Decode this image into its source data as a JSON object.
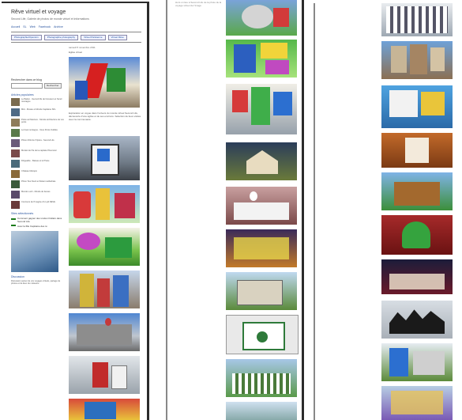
{
  "blog": {
    "title": "Rêve virtuel et voyage",
    "subtitle": "Second Life, Galerie de photos de monde virtuel et informations",
    "nav": [
      "Accueil",
      "SL",
      "Web",
      "Facebook",
      "Archive"
    ],
    "tabs": [
      "Photographie/Opensim",
      "Photographie photography",
      "Virtuel Parisienne",
      "Virtuel Rêve"
    ],
    "post_date": "samedi 5 novembre 2011",
    "post_title": "Eglise virtuel",
    "search_label": "Rechercher dans ce blog",
    "search_button": "Rechercher",
    "sections": {
      "popular": "Articles populaires",
      "selected": "Sites sélectionnés",
      "discussion": "Discussion"
    },
    "articles": [
      "Le Batton - Second life de l'écusson et l'écuil montagne",
      "Mini - Musée et Monde Capitaine SKL",
      "Poste architecture - Monde architecture de vos ponts",
      "Le boat montagne - Vous Ponts Oubliés",
      "Photo 2011 de l'Opéra - Second Life",
      "Mozaic de l'île de la capitale Prisonnier",
      "Dirigeable - Bateau et le Phare",
      "Château Marquis",
      "Photo Tour Deck et flottant cathédrale",
      "Monde Lush - Monde de fauves",
      "Concours de l'Imagine d'un joli REVE"
    ],
    "selected_sites": [
      "Comment gagner des Linden Dollars dans Second Life",
      "Avec la fille Capitaine des ré"
    ],
    "post_text": "Exploration en vogue dans l'univers du monde virtuel Second Life, découverte d'une église et de ses environs. Sélection de lieux visités avec la communauté.",
    "discussion_text": "Discussion autour de vos voyages virtuels, partage de photos et de lieux du métavers."
  },
  "page2": {
    "caption": "Hors un lieu à Second Life de la photo de la voyage virtuel de l'image"
  },
  "colors": {
    "link": "#2a55a0",
    "frame": "#2b2b2b",
    "background": "#ffffff"
  }
}
